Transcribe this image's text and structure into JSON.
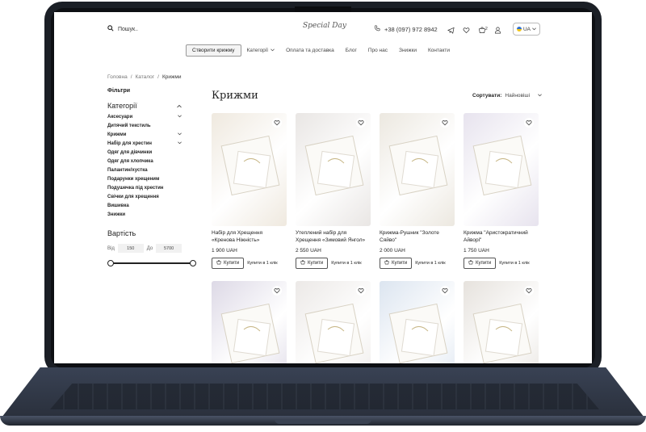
{
  "header": {
    "search_placeholder": "Пошук..",
    "logo_text": "Special Day",
    "phone": "+38 (097) 972 8942",
    "cart_count": "2",
    "lang": "UA"
  },
  "nav": {
    "items": [
      "Створити крижму",
      "Категорії",
      "Оплата та доставка",
      "Блог",
      "Про нас",
      "Знижки",
      "Контакти"
    ]
  },
  "breadcrumbs": [
    "Головна",
    "/",
    "Каталог",
    "/",
    "Крижми"
  ],
  "sidebar": {
    "filters_label": "Фільтри",
    "categories_title": "Категорії",
    "categories": [
      "Аксесуари",
      "Дитячий текстиль",
      "Крижми",
      "Набір для хрестин",
      "Одяг для дівчинки",
      "Одяг для хлопчика",
      "Палантин/хустка",
      "Подарунки хрещеним",
      "Подушечка під хрестин",
      "Свічки для хрещення",
      "Вишивка",
      "Знижки"
    ],
    "price_title": "Вартість",
    "from_label": "Від",
    "from_value": "150",
    "to_label": "До",
    "to_value": "5700"
  },
  "main": {
    "title": "Крижми",
    "sort_label": "Сортувати:",
    "sort_value": "Найновіші",
    "buy_label": "Купити",
    "oneclick_label": "Купити в 1 клік",
    "products": [
      {
        "name": "Набір для Хрещення «Кренова Ніжність»",
        "price": "1 900 UAH",
        "color": "#efe9df"
      },
      {
        "name": "Утеплений набір для Хрещення «Зимовий Янгол»",
        "price": "2 550 UAH",
        "color": "#e9e6e4"
      },
      {
        "name": "Крижма-Рушник \"Золоте Сяйво\"",
        "price": "2 000 UAH",
        "color": "#ece8e0"
      },
      {
        "name": "Крижма \"Аристократичний Айворі\"",
        "price": "1 750 UAH",
        "color": "#e7e3ee"
      },
      {
        "name": "",
        "price": "",
        "color": "#ddd9e6"
      },
      {
        "name": "",
        "price": "",
        "color": "#ece9e7"
      },
      {
        "name": "",
        "price": "",
        "color": "#dce5f0"
      },
      {
        "name": "",
        "price": "",
        "color": "#e6e2dd"
      }
    ]
  }
}
